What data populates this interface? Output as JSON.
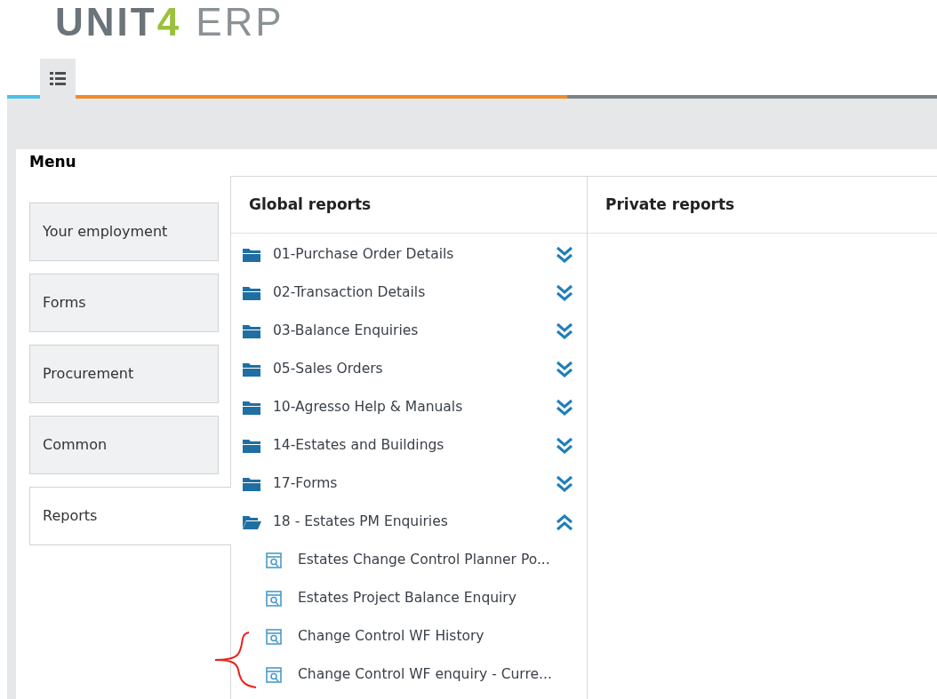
{
  "logo": {
    "word": "UNIT",
    "digit": "4",
    "product": "ERP"
  },
  "tabs": [
    {
      "kind": "menu",
      "selected": true
    }
  ],
  "menu": {
    "title": "Menu",
    "items": [
      {
        "label": "Your employment",
        "selected": false
      },
      {
        "label": "Forms",
        "selected": false
      },
      {
        "label": "Procurement",
        "selected": false
      },
      {
        "label": "Common",
        "selected": false
      },
      {
        "label": "Reports",
        "selected": true
      }
    ]
  },
  "global_reports": {
    "title": "Global reports",
    "folders": [
      {
        "label": "01-Purchase Order Details",
        "expanded": false
      },
      {
        "label": "02-Transaction Details",
        "expanded": false
      },
      {
        "label": "03-Balance Enquiries",
        "expanded": false
      },
      {
        "label": "05-Sales Orders",
        "expanded": false
      },
      {
        "label": "10-Agresso Help & Manuals",
        "expanded": false
      },
      {
        "label": "14-Estates and Buildings",
        "expanded": false
      },
      {
        "label": "17-Forms",
        "expanded": false
      },
      {
        "label": "18 - Estates PM Enquiries",
        "expanded": true,
        "children": [
          {
            "label": "Estates Change Control Planner Po..."
          },
          {
            "label": "Estates Project Balance Enquiry"
          },
          {
            "label": "Change Control WF History"
          },
          {
            "label": "Change Control WF enquiry - Curre..."
          }
        ]
      }
    ]
  },
  "private_reports": {
    "title": "Private reports"
  }
}
